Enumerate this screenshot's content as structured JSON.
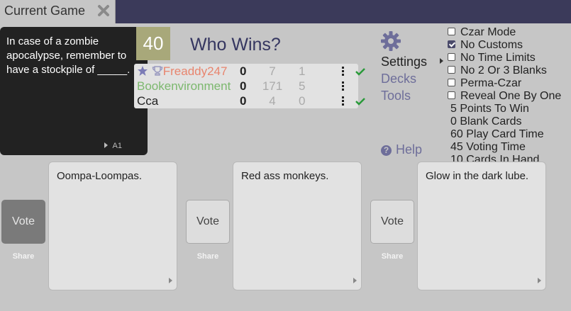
{
  "tab": {
    "label": "Current Game"
  },
  "black_card": {
    "text": "In case of a zombie apocalypse, remember to have a stockpile of _____.",
    "set": "A1"
  },
  "score_limit_display": "40",
  "headline": "Who Wins?",
  "players": [
    {
      "name": "Freaddy247",
      "score": "0",
      "stat1": "7",
      "stat2": "1",
      "name_color": "#e8856e",
      "is_host": true,
      "has_trophy": true,
      "submitted": true
    },
    {
      "name": "Bookenvironment",
      "score": "0",
      "stat1": "171",
      "stat2": "5",
      "name_color": "#7cb86e",
      "is_host": false,
      "has_trophy": false,
      "submitted": false
    },
    {
      "name": "Cca",
      "score": "0",
      "stat1": "4",
      "stat2": "0",
      "name_color": "#222222",
      "is_host": false,
      "has_trophy": false,
      "submitted": true
    }
  ],
  "nav": {
    "settings": "Settings",
    "decks": "Decks",
    "tools": "Tools",
    "help": "Help"
  },
  "settings_options": [
    {
      "label": "Czar Mode",
      "checked": false
    },
    {
      "label": "No Customs",
      "checked": true
    },
    {
      "label": "No Time Limits",
      "checked": false
    },
    {
      "label": "No 2 Or 3 Blanks",
      "checked": false
    },
    {
      "label": "Perma-Czar",
      "checked": false
    },
    {
      "label": "Reveal One By One",
      "checked": false
    }
  ],
  "settings_values": [
    "5 Points To Win",
    "0 Blank Cards",
    "60 Play Card Time",
    "45 Voting Time",
    "10 Cards In Hand"
  ],
  "answers": [
    {
      "text": "Oompa-Loompas.",
      "vote_label": "Vote",
      "share_label": "Share",
      "voted": true
    },
    {
      "text": "Red ass monkeys.",
      "vote_label": "Vote",
      "share_label": "Share",
      "voted": false
    },
    {
      "text": "Glow in the dark lube.",
      "vote_label": "Vote",
      "share_label": "Share",
      "voted": false
    }
  ],
  "colors": {
    "tabbar": "#3b3a5a",
    "background": "#c6c6c6",
    "accent": "#353660",
    "check": "#2a9a3a"
  }
}
